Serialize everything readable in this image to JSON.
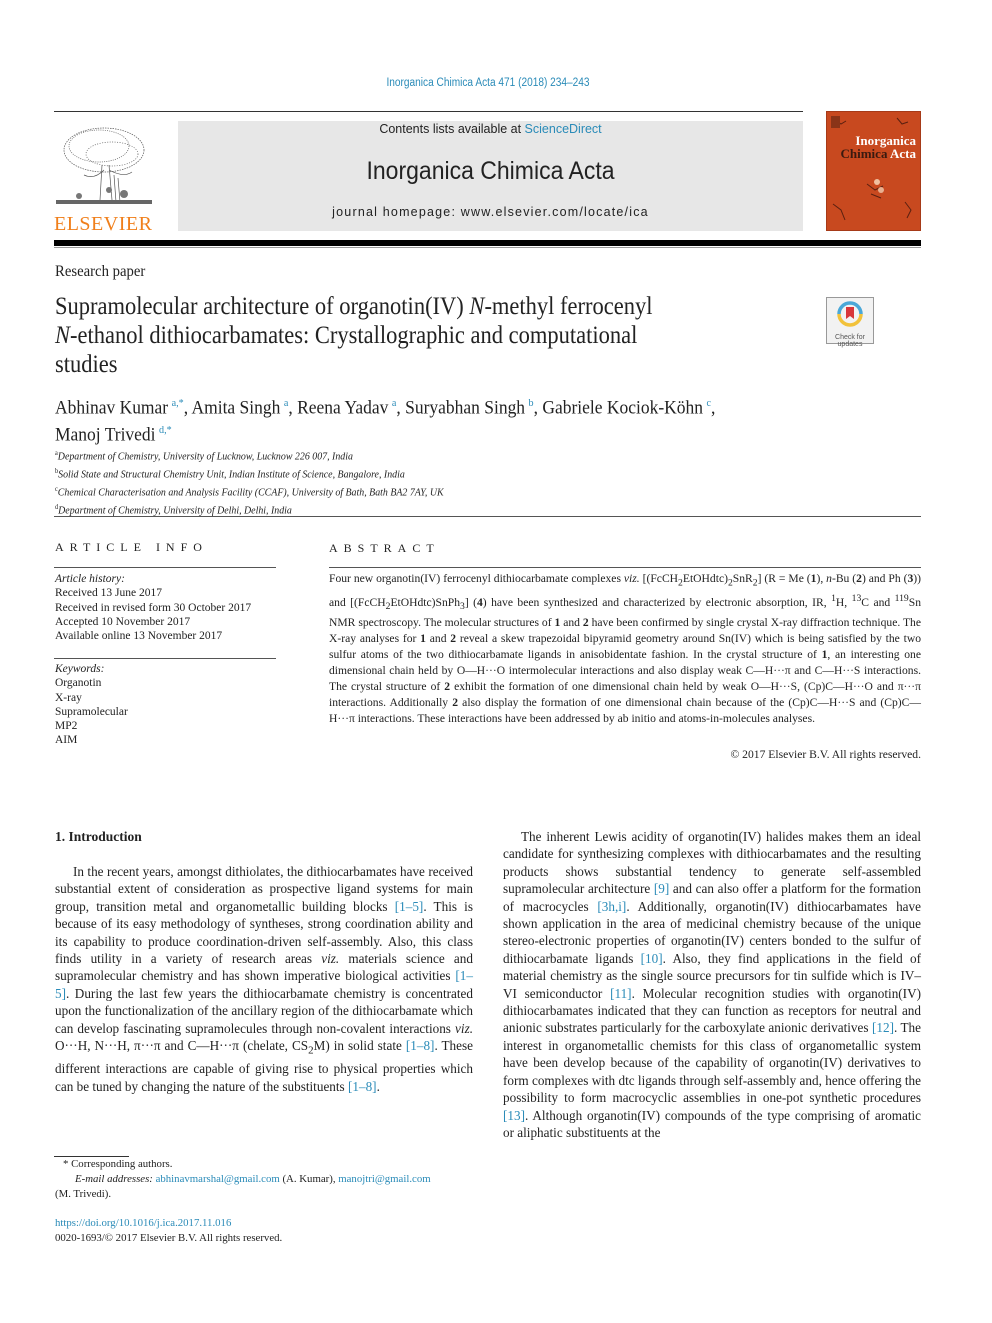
{
  "header": {
    "citation": "Inorganica Chimica Acta 471 (2018) 234–243",
    "contents_prefix": "Contents lists available at ",
    "contents_link": "ScienceDirect",
    "journal_name": "Inorganica Chimica Acta",
    "homepage_label": "journal homepage: ",
    "homepage_url": "www.elsevier.com/locate/ica",
    "publisher_logo_text": "ELSEVIER",
    "cover": {
      "title_line1": "Inorganica",
      "title_line2a": "Chimica",
      "title_line2b": "Acta",
      "bg_color": "#c8491f"
    },
    "check_updates_label_1": "Check for",
    "check_updates_label_2": "updates"
  },
  "article": {
    "type": "Research paper",
    "title_part1": "Supramolecular architecture of organotin(IV) ",
    "title_italic1": "N",
    "title_part2": "-methyl ferrocenyl",
    "title_italic2": "N",
    "title_part3": "-ethanol dithiocarbamates: Crystallographic and computational studies",
    "authors": [
      {
        "name": "Abhinav Kumar",
        "aff": "a,*",
        "sep": ", "
      },
      {
        "name": "Amita Singh",
        "aff": "a",
        "sep": ", "
      },
      {
        "name": "Reena Yadav",
        "aff": "a",
        "sep": ", "
      },
      {
        "name": "Suryabhan Singh",
        "aff": "b",
        "sep": ", "
      },
      {
        "name": "Gabriele Kociok-Köhn",
        "aff": "c",
        "sep": ","
      },
      {
        "name": "Manoj Trivedi",
        "aff": "d,*",
        "sep": ""
      }
    ],
    "affiliations": [
      {
        "key": "a",
        "text": "Department of Chemistry, University of Lucknow, Lucknow 226 007, India"
      },
      {
        "key": "b",
        "text": "Solid State and Structural Chemistry Unit, Indian Institute of Science, Bangalore, India"
      },
      {
        "key": "c",
        "text": "Chemical Characterisation and Analysis Facility (CCAF), University of Bath, Bath BA2 7AY, UK"
      },
      {
        "key": "d",
        "text": "Department of Chemistry, University of Delhi, Delhi, India"
      }
    ]
  },
  "article_info": {
    "heading": "ARTICLE INFO",
    "history_label": "Article history:",
    "history": [
      "Received 13 June 2017",
      "Received in revised form 30 October 2017",
      "Accepted 10 November 2017",
      "Available online 13 November 2017"
    ],
    "keywords_label": "Keywords:",
    "keywords": [
      "Organotin",
      "X-ray",
      "Supramolecular",
      "MP2",
      "AIM"
    ]
  },
  "abstract": {
    "heading": "ABSTRACT",
    "text_html": "Four new organotin(IV) ferrocenyl dithiocarbamate complexes <i>viz.</i> [(FcCH<sub>2</sub>EtOHdtc)<sub>2</sub>SnR<sub>2</sub>] (R = Me (<b>1</b>), <i>n</i>-Bu (<b>2</b>) and Ph (<b>3</b>)) and [(FcCH<sub>2</sub>EtOHdtc)SnPh<sub>3</sub>] (<b>4</b>) have been synthesized and characterized by electronic absorption, IR, <sup>1</sup>H, <sup>13</sup>C and <sup>119</sup>Sn NMR spectroscopy. The molecular structures of <b>1</b> and <b>2</b> have been confirmed by single crystal X-ray diffraction technique. The X-ray analyses for <b>1</b> and <b>2</b> reveal a skew trapezoidal bipyramid geometry around Sn(IV) which is being satisfied by the two sulfur atoms of the two dithiocarbamate ligands in anisobidentate fashion. In the crystal structure of <b>1</b>, an interesting one dimensional chain held by O—H···O intermolecular interactions and also display weak C—H···π and C—H···S interactions. The crystal structure of <b>2</b> exhibit the formation of one dimensional chain held by weak O—H···S, (Cp)C—H···O and π···π interactions. Additionally <b>2</b> also display the formation of one dimensional chain because of the (Cp)C—H···S and (Cp)C—H···π interactions. These interactions have been addressed by ab initio and atoms-in-molecules analyses.",
    "copyright": "© 2017 Elsevier B.V. All rights reserved."
  },
  "body": {
    "intro_heading": "1. Introduction",
    "left_paragraph_html": "In the recent years, amongst dithiolates, the dithiocarbamates have received substantial extent of consideration as prospective ligand systems for main group, transition metal and organometallic building blocks <span class=\"ref\">[1–5]</span>. This is because of its easy methodology of syntheses, strong coordination ability and its capability to produce coordination-driven self-assembly. Also, this class finds utility in a variety of research areas <i>viz.</i> materials science and supramolecular chemistry and has shown imperative biological activities <span class=\"ref\">[1–5]</span>. During the last few years the dithiocarbamate chemistry is concentrated upon the functionalization of the ancillary region of the dithiocarbamate which can develop fascinating supramolecules through non-covalent interactions <i>viz.</i> O···H, N···H, π···π and C—H···π (chelate, CS<sub>2</sub>M) in solid state <span class=\"ref\">[1–8]</span>. These different interactions are capable of giving rise to physical properties which can be tuned by changing the nature of the substituents <span class=\"ref\">[1–8]</span>.",
    "right_paragraph_html": "The inherent Lewis acidity of organotin(IV) halides makes them an ideal candidate for synthesizing complexes with dithiocarbamates and the resulting products shows substantial tendency to generate self-assembled supramolecular architecture <span class=\"ref\">[9]</span> and can also offer a platform for the formation of macrocycles <span class=\"ref\">[3h,i]</span>. Additionally, organotin(IV) dithiocarbamates have shown application in the area of medicinal chemistry because of the unique stereo-electronic properties of organotin(IV) centers bonded to the sulfur of dithiocarbamate ligands <span class=\"ref\">[10]</span>. Also, they find applications in the field of material chemistry as the single source precursors for tin sulfide which is IV–VI semiconductor <span class=\"ref\">[11]</span>. Molecular recognition studies with organotin(IV) dithiocarbamates indicated that they can function as receptors for neutral and anionic substrates particularly for the carboxylate anionic derivatives <span class=\"ref\">[12]</span>. The interest in organometallic chemists for this class of organometallic system have been develop because of the capability of organotin(IV) derivatives to form complexes with dtc ligands through self-assembly and, hence offering the possibility to form macrocyclic assemblies in one-pot synthetic procedures <span class=\"ref\">[13]</span>. Although organotin(IV) compounds of the type comprising of aromatic or aliphatic substituents at the"
  },
  "footnotes": {
    "corresponding": "* Corresponding authors.",
    "email_label": "E-mail addresses: ",
    "email1": "abhinavmarshal@gmail.com",
    "email1_owner": " (A. Kumar), ",
    "email2": "manojtri@gmail.com",
    "email2_owner": "(M. Trivedi).",
    "doi": "https://doi.org/10.1016/j.ica.2017.11.016",
    "issn_copyright": "0020-1693/© 2017 Elsevier B.V. All rights reserved."
  }
}
